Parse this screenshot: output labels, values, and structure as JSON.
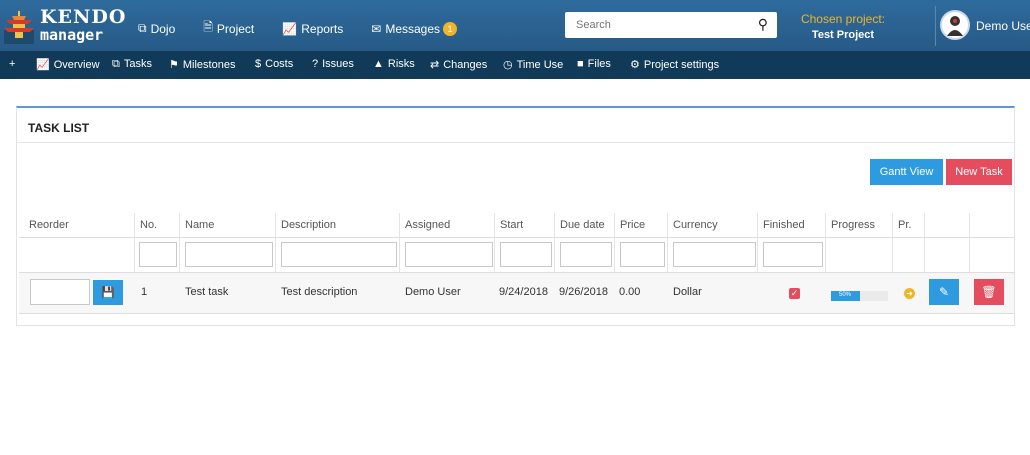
{
  "brand": {
    "line1": "KENDO",
    "line2": "manager"
  },
  "nav": {
    "items": [
      {
        "icon": "square-icon",
        "glyph": "⧉",
        "label": "Dojo"
      },
      {
        "icon": "document-icon",
        "glyph": "🗎",
        "label": "Project"
      },
      {
        "icon": "line-chart-icon",
        "glyph": "📈",
        "label": "Reports"
      },
      {
        "icon": "envelope-icon",
        "glyph": "✉",
        "label": "Messages"
      }
    ],
    "messages_badge": "1"
  },
  "search": {
    "placeholder": "Search"
  },
  "project": {
    "label": "Chosen project:",
    "name": "Test Project"
  },
  "user": {
    "name": "Demo User"
  },
  "subnav": [
    {
      "icon": "plus-icon",
      "glyph": "+",
      "label": ""
    },
    {
      "icon": "area-chart-icon",
      "glyph": "📈",
      "label": "Overview"
    },
    {
      "icon": "copy-icon",
      "glyph": "⧉",
      "label": "Tasks"
    },
    {
      "icon": "flag-icon",
      "glyph": "⚑",
      "label": "Milestones"
    },
    {
      "icon": "dollar-icon",
      "glyph": "$",
      "label": "Costs"
    },
    {
      "icon": "question-icon",
      "glyph": "?",
      "label": "Issues"
    },
    {
      "icon": "warning-icon",
      "glyph": "▲",
      "label": "Risks"
    },
    {
      "icon": "exchange-icon",
      "glyph": "⇄",
      "label": "Changes"
    },
    {
      "icon": "clock-icon",
      "glyph": "◷",
      "label": "Time Use"
    },
    {
      "icon": "folder-icon",
      "glyph": "■",
      "label": "Files"
    },
    {
      "icon": "cogs-icon",
      "glyph": "⚙",
      "label": "Project settings"
    }
  ],
  "panel": {
    "title": "TASK LIST",
    "gantt_label": "Gantt View",
    "new_task_label": "New Task"
  },
  "table": {
    "headers": [
      "Reorder",
      "No.",
      "Name",
      "Description",
      "Assigned",
      "Start",
      "Due date",
      "Price",
      "Currency",
      "Finished",
      "Progress",
      "Pr."
    ],
    "rows": [
      {
        "no": "1",
        "name": "Test task",
        "description": "Test description",
        "assigned": "Demo User",
        "start": "9/24/2018",
        "due": "9/26/2018",
        "price": "0.00",
        "currency": "Dollar",
        "finished": true,
        "progress": 50,
        "progress_label": "50%"
      }
    ]
  },
  "colors": {
    "topbar": "#2a5f8f",
    "subbar": "#103a57",
    "primary": "#2e9be1",
    "danger": "#e44d5e",
    "accent": "#f0b429"
  }
}
